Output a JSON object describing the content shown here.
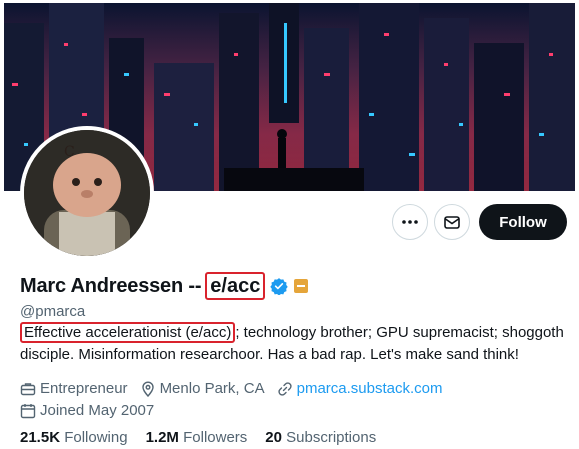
{
  "profile": {
    "name": "Marc Andreessen --",
    "name_tag": "e/acc",
    "handle": "@pmarca",
    "bio_highlight": "Effective accelerationist (e/acc)",
    "bio_rest": "; technology brother; GPU supremacist; shoggoth disciple. Misinformation researchoor. Has a bad rap. Let's make sand think!",
    "category": "Entrepreneur",
    "location": "Menlo Park, CA",
    "website": "pmarca.substack.com",
    "joined": "Joined May 2007",
    "verified_icon": "verified-badge-icon",
    "affiliate_icon": "affiliate-badge-icon"
  },
  "actions": {
    "more_icon": "more-icon",
    "message_icon": "envelope-icon",
    "follow_label": "Follow"
  },
  "stats": {
    "following_count": "21.5K",
    "following_label": "Following",
    "followers_count": "1.2M",
    "followers_label": "Followers",
    "subscriptions_count": "20",
    "subscriptions_label": "Subscriptions"
  },
  "colors": {
    "highlight_border": "#d9232d",
    "link": "#1d9bf0",
    "verified": "#1d9bf0",
    "follow_bg": "#0f1419",
    "muted_text": "#536471"
  }
}
